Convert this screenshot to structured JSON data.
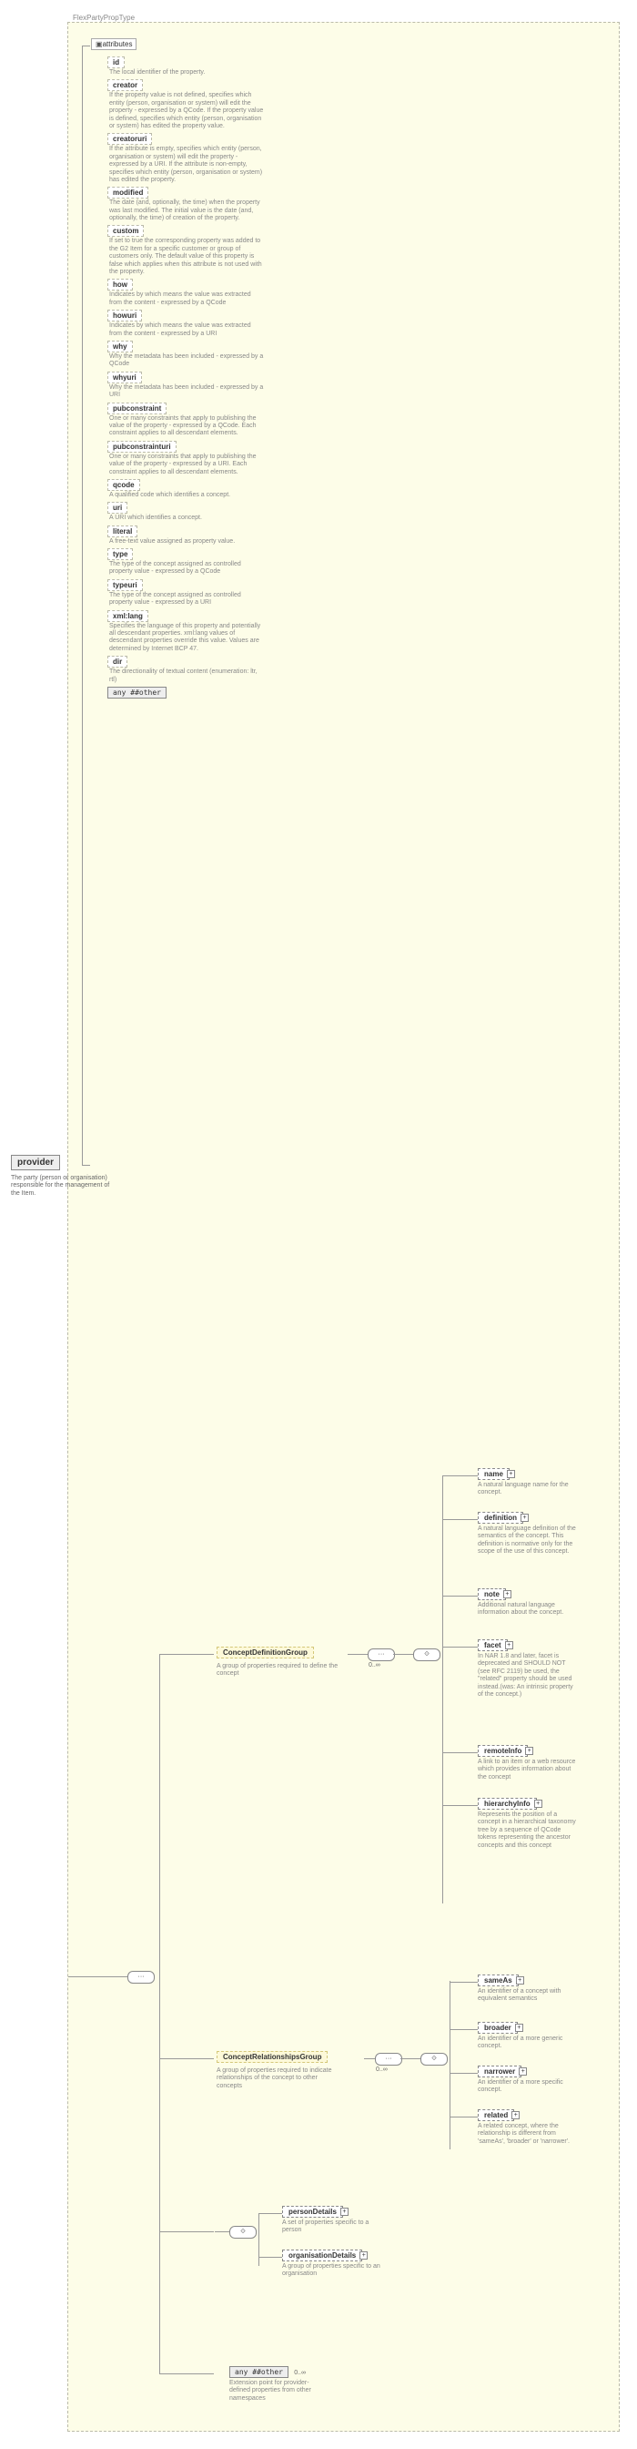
{
  "typeLabel": "FlexPartyPropType",
  "provider": {
    "name": "provider",
    "desc": "The party (person or organisation) responsible for the management of the Item."
  },
  "attributesHeader": "attributes",
  "attributes": [
    {
      "name": "id",
      "desc": "The local identifier of the property."
    },
    {
      "name": "creator",
      "desc": "If the property value is not defined, specifies which entity (person, organisation or system) will edit the property - expressed by a QCode. If the property value is defined, specifies which entity (person, organisation or system) has edited the property value."
    },
    {
      "name": "creatoruri",
      "desc": "If the attribute is empty, specifies which entity (person, organisation or system) will edit the property - expressed by a URI. If the attribute is non-empty, specifies which entity (person, organisation or system) has edited the property."
    },
    {
      "name": "modified",
      "desc": "The date (and, optionally, the time) when the property was last modified. The initial value is the date (and, optionally, the time) of creation of the property."
    },
    {
      "name": "custom",
      "desc": "If set to true the corresponding property was added to the G2 Item for a specific customer or group of customers only. The default value of this property is false which applies when this attribute is not used with the property."
    },
    {
      "name": "how",
      "desc": "Indicates by which means the value was extracted from the content - expressed by a QCode"
    },
    {
      "name": "howuri",
      "desc": "Indicates by which means the value was extracted from the content - expressed by a URI"
    },
    {
      "name": "why",
      "desc": "Why the metadata has been included - expressed by a QCode"
    },
    {
      "name": "whyuri",
      "desc": "Why the metadata has been included - expressed by a URI"
    },
    {
      "name": "pubconstraint",
      "desc": "One or many constraints that apply to publishing the value of the property - expressed by a QCode. Each constraint applies to all descendant elements."
    },
    {
      "name": "pubconstrainturi",
      "desc": "One or many constraints that apply to publishing the value of the property - expressed by a URI. Each constraint applies to all descendant elements."
    },
    {
      "name": "qcode",
      "desc": "A qualified code which identifies a concept."
    },
    {
      "name": "uri",
      "desc": "A URI which identifies a concept."
    },
    {
      "name": "literal",
      "desc": "A free-text value assigned as property value."
    },
    {
      "name": "type",
      "desc": "The type of the concept assigned as controlled property value - expressed by a QCode"
    },
    {
      "name": "typeuri",
      "desc": "The type of the concept assigned as controlled property value - expressed by a URI"
    },
    {
      "name": "xml:lang",
      "desc": "Specifies the language of this property and potentially all descendant properties. xml:lang values of descendant properties override this value. Values are determined by Internet BCP 47."
    },
    {
      "name": "dir",
      "desc": "The directionality of textual content (enumeration: ltr, rtl)"
    }
  ],
  "anyOtherAttr": "any ##other",
  "groups": {
    "cdg": {
      "name": "ConceptDefinitionGroup",
      "desc": "A group of properties required to define the concept",
      "card": "0..∞"
    },
    "crg": {
      "name": "ConceptRelationshipsGroup",
      "desc": "A group of properties required to indicate relationships of the concept to other concepts",
      "card": "0..∞"
    }
  },
  "cdgLeaves": [
    {
      "name": "name",
      "desc": "A natural language name for the concept."
    },
    {
      "name": "definition",
      "desc": "A natural language definition of the semantics of the concept. This definition is normative only for the scope of the use of this concept."
    },
    {
      "name": "note",
      "desc": "Additional natural language information about the concept."
    },
    {
      "name": "facet",
      "desc": "In NAR 1.8 and later, facet is deprecated and SHOULD NOT (see RFC 2119) be used, the \"related\" property should be used instead.(was: An intrinsic property of the concept.)"
    },
    {
      "name": "remoteInfo",
      "desc": "A link to an item or a web resource which provides information about the concept"
    },
    {
      "name": "hierarchyInfo",
      "desc": "Represents the position of a concept in a hierarchical taxonomy tree by a sequence of QCode tokens representing the ancestor concepts and this concept"
    }
  ],
  "crgLeaves": [
    {
      "name": "sameAs",
      "desc": "An identifier of a concept with equivalent semantics"
    },
    {
      "name": "broader",
      "desc": "An identifier of a more generic concept."
    },
    {
      "name": "narrower",
      "desc": "An identifier of a more specific concept."
    },
    {
      "name": "related",
      "desc": "A related concept, where the relationship is different from 'sameAs', 'broader' or 'narrower'."
    }
  ],
  "partyGroup": [
    {
      "name": "personDetails",
      "desc": "A set of properties specific to a person"
    },
    {
      "name": "organisationDetails",
      "desc": "A group of properties specific to an organisation"
    }
  ],
  "anyOtherEl": {
    "label": "any ##other",
    "desc": "Extension point for provider-defined properties from other namespaces",
    "card": "0..∞"
  }
}
